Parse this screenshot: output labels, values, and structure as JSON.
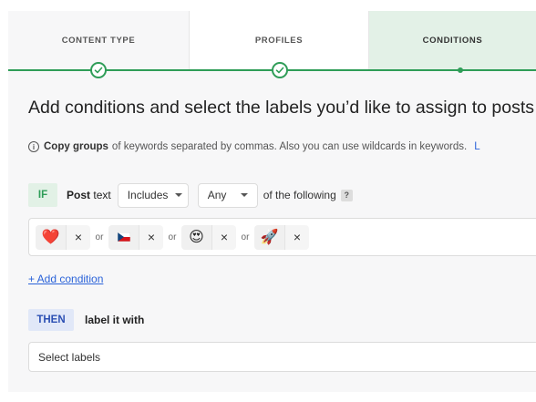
{
  "steps": [
    {
      "label": "CONTENT TYPE",
      "state": "completed"
    },
    {
      "label": "PROFILES",
      "state": "completed"
    },
    {
      "label": "CONDITIONS",
      "state": "current"
    }
  ],
  "colors": {
    "accent_green": "#2f9d58",
    "active_tab_bg": "#e3f1e7",
    "link_blue": "#2b63d9",
    "then_badge_bg": "#e1e8f8"
  },
  "title": "Add conditions and select the labels you’d like to assign to posts",
  "hint": {
    "icon": "info-icon",
    "bold": "Copy groups",
    "text": "of keywords separated by commas. Also you can use wildcards in keywords.",
    "link": "L"
  },
  "condition": {
    "if_badge": "IF",
    "field_bold": "Post",
    "field_rest": "text",
    "operator": "Includes",
    "quantifier": "Any",
    "following": "of the following",
    "help_badge": "?",
    "or_label": "or",
    "tags": [
      {
        "emoji": "❤️",
        "name": "red-heart"
      },
      {
        "emoji": "🇨🇿",
        "name": "czech-flag"
      },
      {
        "emoji": "😍",
        "name": "heart-eyes"
      },
      {
        "emoji": "🚀",
        "name": "rocket"
      }
    ],
    "remove_symbol": "×"
  },
  "add_condition": "+ Add condition",
  "action": {
    "then_badge": "THEN",
    "label": "label it with",
    "select_placeholder": "Select labels"
  }
}
